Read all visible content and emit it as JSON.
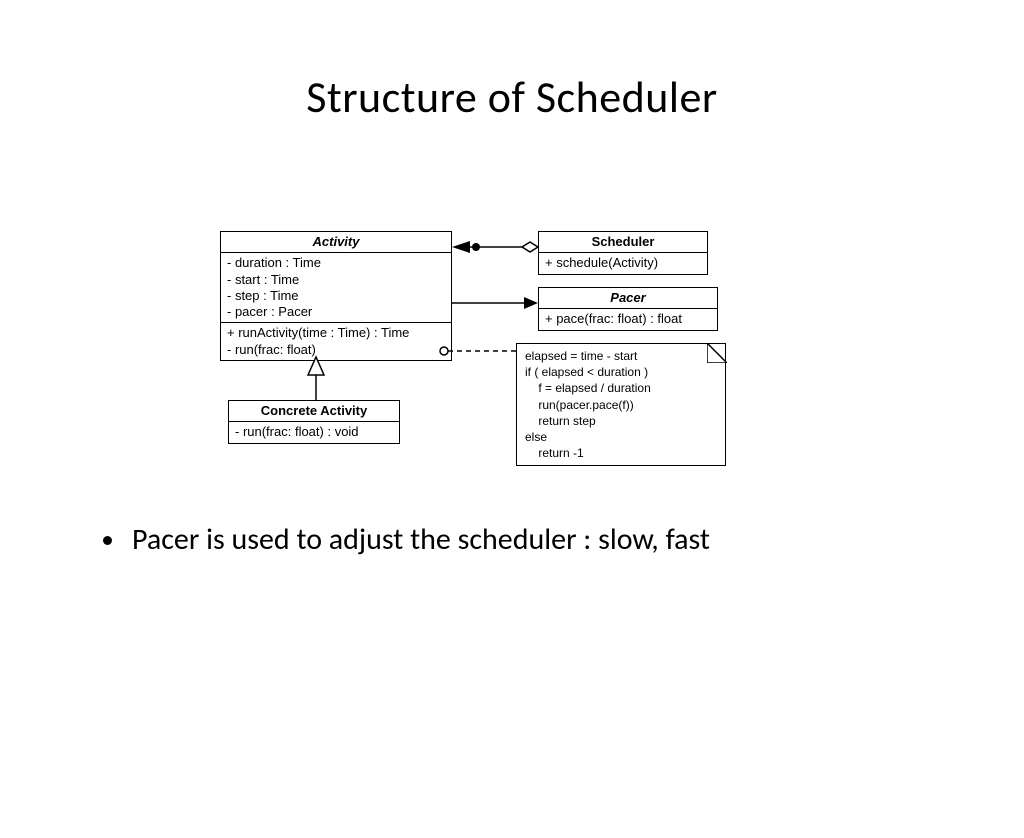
{
  "title": "Structure of Scheduler",
  "bullet1": "Pacer is used to adjust the scheduler : slow, fast",
  "activity": {
    "name": "Activity",
    "attr1": "- duration : Time",
    "attr2": "- start : Time",
    "attr3": "- step : Time",
    "attr4": "- pacer : Pacer",
    "op1": "+ runActivity(time : Time) : Time",
    "op2": "- run(frac: float)"
  },
  "scheduler": {
    "name": "Scheduler",
    "op1": "+ schedule(Activity)"
  },
  "pacer": {
    "name": "Pacer",
    "op1": "+ pace(frac: float) : float"
  },
  "concrete": {
    "name": "Concrete Activity",
    "op1": "- run(frac: float) : void"
  },
  "note": "elapsed = time - start\nif ( elapsed < duration )\n    f = elapsed / duration\n    run(pacer.pace(f))\n    return step\nelse\n    return -1"
}
